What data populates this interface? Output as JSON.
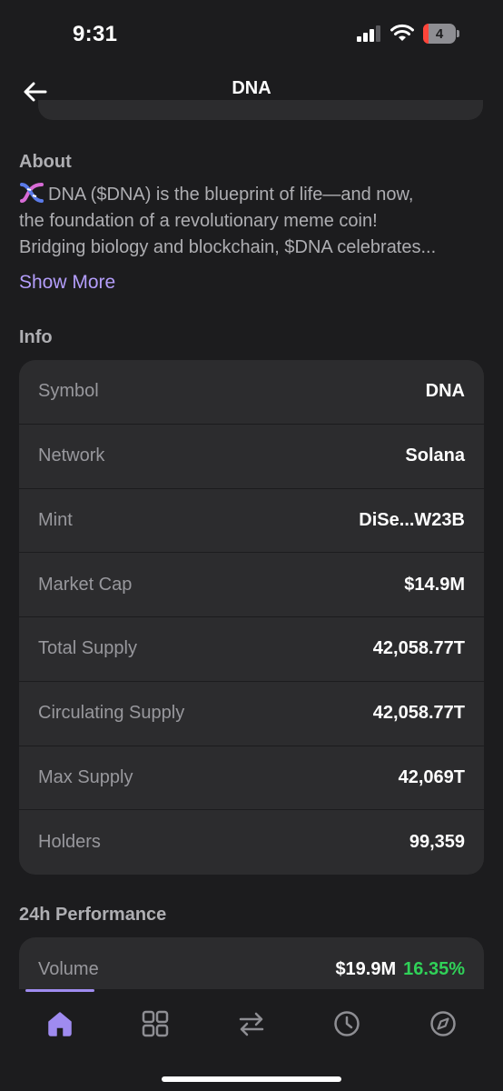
{
  "status_bar": {
    "time": "9:31",
    "battery_level": "4"
  },
  "header": {
    "title": "DNA",
    "back_icon": "arrow-left-icon"
  },
  "about": {
    "title": "About",
    "lines": [
      "DNA ($DNA) is the blueprint of life—and now,",
      "the foundation of a revolutionary meme coin!",
      "Bridging biology and blockchain, $DNA celebrates..."
    ],
    "emoji_icon": "dna-icon",
    "show_more": "Show More"
  },
  "info": {
    "title": "Info",
    "rows": [
      {
        "label": "Symbol",
        "value": "DNA"
      },
      {
        "label": "Network",
        "value": "Solana"
      },
      {
        "label": "Mint",
        "value": "DiSe...W23B"
      },
      {
        "label": "Market Cap",
        "value": "$14.9M"
      },
      {
        "label": "Total Supply",
        "value": "42,058.77T"
      },
      {
        "label": "Circulating Supply",
        "value": "42,058.77T"
      },
      {
        "label": "Max Supply",
        "value": "42,069T"
      },
      {
        "label": "Holders",
        "value": "99,359"
      }
    ]
  },
  "performance": {
    "title": "24h Performance",
    "volume_label": "Volume",
    "volume_value": "$19.9M",
    "volume_change": "16.35%"
  },
  "tab_bar": {
    "tabs": [
      {
        "icon": "home-icon",
        "active": true
      },
      {
        "icon": "grid-icon",
        "active": false
      },
      {
        "icon": "swap-icon",
        "active": false
      },
      {
        "icon": "clock-icon",
        "active": false
      },
      {
        "icon": "compass-icon",
        "active": false
      }
    ]
  },
  "colors": {
    "background": "#1c1c1e",
    "card": "#2c2c2e",
    "accent": "#b39dfa",
    "positive": "#30d158"
  }
}
